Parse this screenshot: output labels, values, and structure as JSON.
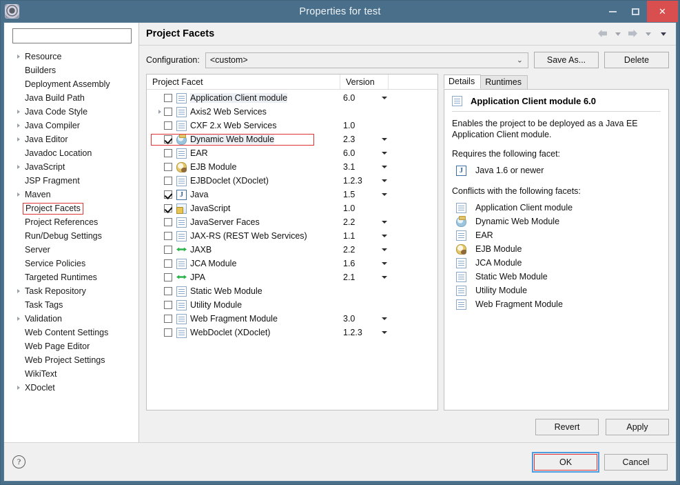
{
  "window": {
    "title": "Properties for test",
    "app_icon": "gear-icon",
    "minimize_label": "Minimize",
    "maximize_label": "Maximize",
    "close_label": "Close"
  },
  "sidebar": {
    "search_value": "",
    "search_placeholder": "",
    "items": [
      {
        "label": "Resource",
        "expandable": true
      },
      {
        "label": "Builders",
        "expandable": false
      },
      {
        "label": "Deployment Assembly",
        "expandable": false
      },
      {
        "label": "Java Build Path",
        "expandable": false
      },
      {
        "label": "Java Code Style",
        "expandable": true
      },
      {
        "label": "Java Compiler",
        "expandable": true
      },
      {
        "label": "Java Editor",
        "expandable": true
      },
      {
        "label": "Javadoc Location",
        "expandable": false
      },
      {
        "label": "JavaScript",
        "expandable": true
      },
      {
        "label": "JSP Fragment",
        "expandable": false
      },
      {
        "label": "Maven",
        "expandable": true
      },
      {
        "label": "Project Facets",
        "expandable": false,
        "annotated": true
      },
      {
        "label": "Project References",
        "expandable": false
      },
      {
        "label": "Run/Debug Settings",
        "expandable": false
      },
      {
        "label": "Server",
        "expandable": false
      },
      {
        "label": "Service Policies",
        "expandable": false
      },
      {
        "label": "Targeted Runtimes",
        "expandable": false
      },
      {
        "label": "Task Repository",
        "expandable": true
      },
      {
        "label": "Task Tags",
        "expandable": false
      },
      {
        "label": "Validation",
        "expandable": true
      },
      {
        "label": "Web Content Settings",
        "expandable": false
      },
      {
        "label": "Web Page Editor",
        "expandable": false
      },
      {
        "label": "Web Project Settings",
        "expandable": false
      },
      {
        "label": "WikiText",
        "expandable": false
      },
      {
        "label": "XDoclet",
        "expandable": true
      }
    ]
  },
  "page": {
    "title": "Project Facets",
    "nav": {
      "back_icon": "arrow-left-icon",
      "back_menu_icon": "chevron-down-icon",
      "forward_icon": "arrow-right-icon",
      "forward_menu_icon": "chevron-down-icon",
      "view_menu_icon": "chevron-down-icon"
    }
  },
  "configuration": {
    "label": "Configuration:",
    "value": "<custom>",
    "dropdown_icon": "chevron-down-icon",
    "save_as_label": "Save As...",
    "delete_label": "Delete"
  },
  "facet_table": {
    "columns": [
      "Project Facet",
      "Version",
      ""
    ],
    "rows": [
      {
        "name": "Application Client module",
        "version": "6.0",
        "checked": false,
        "expandable": false,
        "has_version_dropdown": true,
        "icon": "doc-icon",
        "shaded": true
      },
      {
        "name": "Axis2 Web Services",
        "version": "",
        "checked": false,
        "expandable": true,
        "has_version_dropdown": false,
        "icon": "doc-icon",
        "shaded": false
      },
      {
        "name": "CXF 2.x Web Services",
        "version": "1.0",
        "checked": false,
        "expandable": false,
        "has_version_dropdown": false,
        "icon": "doc-icon",
        "shaded": false
      },
      {
        "name": "Dynamic Web Module",
        "version": "2.3",
        "checked": true,
        "expandable": false,
        "has_version_dropdown": true,
        "icon": "globe-icon",
        "shaded": true,
        "annotated": true
      },
      {
        "name": "EAR",
        "version": "6.0",
        "checked": false,
        "expandable": false,
        "has_version_dropdown": true,
        "icon": "doc-icon",
        "shaded": false
      },
      {
        "name": "EJB Module",
        "version": "3.1",
        "checked": false,
        "expandable": false,
        "has_version_dropdown": true,
        "icon": "ejb-icon",
        "shaded": false
      },
      {
        "name": "EJBDoclet (XDoclet)",
        "version": "1.2.3",
        "checked": false,
        "expandable": false,
        "has_version_dropdown": true,
        "icon": "doc-icon",
        "shaded": false
      },
      {
        "name": "Java",
        "version": "1.5",
        "checked": true,
        "expandable": false,
        "has_version_dropdown": true,
        "icon": "java-icon",
        "shaded": false
      },
      {
        "name": "JavaScript",
        "version": "1.0",
        "checked": true,
        "expandable": false,
        "has_version_dropdown": false,
        "icon": "js-icon",
        "shaded": false
      },
      {
        "name": "JavaServer Faces",
        "version": "2.2",
        "checked": false,
        "expandable": false,
        "has_version_dropdown": true,
        "icon": "doc-icon",
        "shaded": false
      },
      {
        "name": "JAX-RS (REST Web Services)",
        "version": "1.1",
        "checked": false,
        "expandable": false,
        "has_version_dropdown": true,
        "icon": "doc-icon",
        "shaded": false
      },
      {
        "name": "JAXB",
        "version": "2.2",
        "checked": false,
        "expandable": false,
        "has_version_dropdown": true,
        "icon": "xfer-icon",
        "shaded": false
      },
      {
        "name": "JCA Module",
        "version": "1.6",
        "checked": false,
        "expandable": false,
        "has_version_dropdown": true,
        "icon": "doc-icon",
        "shaded": false
      },
      {
        "name": "JPA",
        "version": "2.1",
        "checked": false,
        "expandable": false,
        "has_version_dropdown": true,
        "icon": "xfer-icon",
        "shaded": false
      },
      {
        "name": "Static Web Module",
        "version": "",
        "checked": false,
        "expandable": false,
        "has_version_dropdown": false,
        "icon": "doc-icon",
        "shaded": false
      },
      {
        "name": "Utility Module",
        "version": "",
        "checked": false,
        "expandable": false,
        "has_version_dropdown": false,
        "icon": "doc-icon",
        "shaded": false
      },
      {
        "name": "Web Fragment Module",
        "version": "3.0",
        "checked": false,
        "expandable": false,
        "has_version_dropdown": true,
        "icon": "doc-icon",
        "shaded": false
      },
      {
        "name": "WebDoclet (XDoclet)",
        "version": "1.2.3",
        "checked": false,
        "expandable": false,
        "has_version_dropdown": true,
        "icon": "doc-icon",
        "shaded": false
      }
    ]
  },
  "details": {
    "tabs": [
      {
        "label": "Details",
        "active": true
      },
      {
        "label": "Runtimes",
        "active": false
      }
    ],
    "heading": "Application Client module 6.0",
    "heading_icon": "doc-icon",
    "description": "Enables the project to be deployed as a Java EE Application Client module.",
    "requires_label": "Requires the following facet:",
    "requires": [
      {
        "name": "Java 1.6 or newer",
        "icon": "java-icon"
      }
    ],
    "conflicts_label": "Conflicts with the following facets:",
    "conflicts": [
      {
        "name": "Application Client module",
        "icon": "doc-icon"
      },
      {
        "name": "Dynamic Web Module",
        "icon": "globe-icon"
      },
      {
        "name": "EAR",
        "icon": "doc-icon"
      },
      {
        "name": "EJB Module",
        "icon": "ejb-icon"
      },
      {
        "name": "JCA Module",
        "icon": "doc-icon"
      },
      {
        "name": "Static Web Module",
        "icon": "doc-icon"
      },
      {
        "name": "Utility Module",
        "icon": "doc-icon"
      },
      {
        "name": "Web Fragment Module",
        "icon": "doc-icon"
      }
    ]
  },
  "actions": {
    "revert_label": "Revert",
    "apply_label": "Apply",
    "ok_label": "OK",
    "cancel_label": "Cancel",
    "help_icon": "question-mark-icon",
    "help_glyph": "?"
  },
  "colors": {
    "titlebar": "#4a6f8a",
    "close_button": "#d94f4f",
    "annotation": "#e03232",
    "focus_ring": "#4a9ee0",
    "dialog_bg": "#f0f0f0"
  }
}
